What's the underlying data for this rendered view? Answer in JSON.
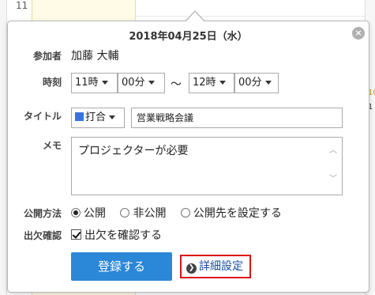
{
  "background": {
    "day_number": "11",
    "side_marker_1": "10",
    "side_marker_2": "1"
  },
  "popup": {
    "date_title": "2018年04月25日（水）",
    "close_icon_glyph": "×",
    "participants": {
      "label": "参加者",
      "value": "加藤 大輔"
    },
    "time": {
      "label": "時刻",
      "start_hour": "11時",
      "start_minute": "00分",
      "separator": "～",
      "end_hour": "12時",
      "end_minute": "00分"
    },
    "title": {
      "label": "タイトル",
      "category": "打合",
      "category_color": "#3377dd",
      "value": "営業戦略会議"
    },
    "memo": {
      "label": "メモ",
      "value": "プロジェクターが必要"
    },
    "visibility": {
      "label": "公開方法",
      "options": [
        "公開",
        "非公開",
        "公開先を設定する"
      ],
      "selected": "公開"
    },
    "attendance": {
      "label": "出欠確認",
      "checkbox_label": "出欠を確認する",
      "checked": true
    },
    "register_button": "登録する",
    "detail_link": "詳細設定",
    "colors": {
      "primary": "#2b87d8",
      "highlight_border": "#e01010"
    }
  }
}
